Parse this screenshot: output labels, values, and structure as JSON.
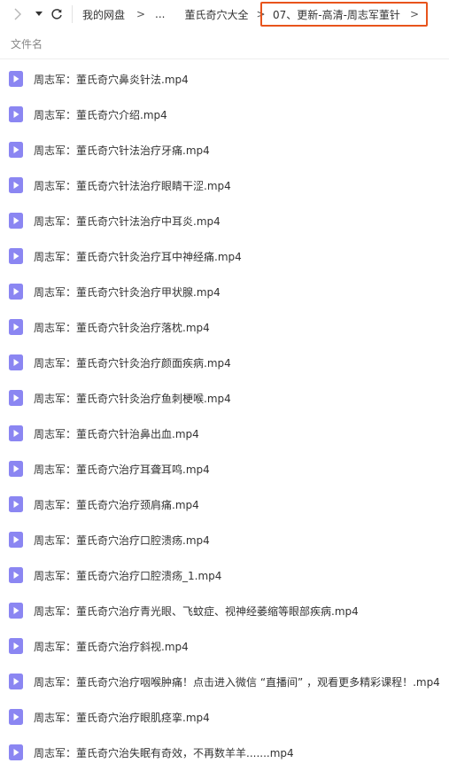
{
  "toolbar": {
    "forward_icon": "chevron-right-icon",
    "dropdown_icon": "caret-down-icon",
    "refresh_icon": "refresh-icon",
    "breadcrumb": {
      "root": "我的网盘",
      "sep1": ">",
      "ellipsis": "...",
      "folder": "董氏奇穴大全",
      "sep2": ">",
      "current": "07、更新-高清-周志军董针",
      "sep3": ">"
    },
    "highlight_color": "#e8541c"
  },
  "list": {
    "header_filename": "文件名",
    "file_icon": "video-file-icon",
    "icon_color": "#8b86f2",
    "files": [
      "周志军：董氏奇穴鼻炎针法.mp4",
      "周志军：董氏奇穴介绍.mp4",
      "周志军：董氏奇穴针法治疗牙痛.mp4",
      "周志军：董氏奇穴针法治疗眼睛干涩.mp4",
      "周志军：董氏奇穴针法治疗中耳炎.mp4",
      "周志军：董氏奇穴针灸治疗耳中神经痛.mp4",
      "周志军：董氏奇穴针灸治疗甲状腺.mp4",
      "周志军：董氏奇穴针灸治疗落枕.mp4",
      "周志军：董氏奇穴针灸治疗颜面疾病.mp4",
      "周志军：董氏奇穴针灸治疗鱼刺梗喉.mp4",
      "周志军：董氏奇穴针治鼻出血.mp4",
      "周志军：董氏奇穴治疗耳聋耳鸣.mp4",
      "周志军：董氏奇穴治疗颈肩痛.mp4",
      "周志军：董氏奇穴治疗口腔溃疡.mp4",
      "周志军：董氏奇穴治疗口腔溃疡_1.mp4",
      "周志军：董氏奇穴治疗青光眼、飞蚊症、视神经萎缩等眼部疾病.mp4",
      "周志军：董氏奇穴治疗斜视.mp4",
      "周志军：董氏奇穴治疗咽喉肿痛！点击进入微信 “直播间” ，观看更多精彩课程！.mp4",
      "周志军：董氏奇穴治疗眼肌痉挛.mp4",
      "周志军：董氏奇穴治失眠有奇效，不再数羊羊.......mp4"
    ]
  }
}
